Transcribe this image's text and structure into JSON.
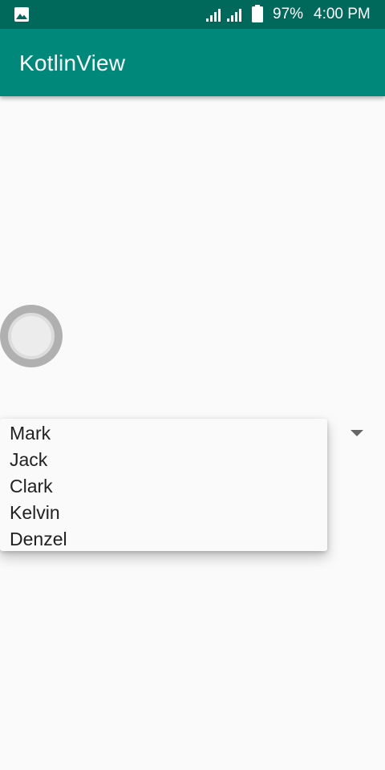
{
  "status_bar": {
    "notification_icon": "image-icon",
    "battery": "97%",
    "time": "4:00 PM"
  },
  "app_bar": {
    "title": "KotlinView"
  },
  "radio_button": {
    "checked": false
  },
  "spinner": {
    "dropdown_open": true,
    "options": [
      "Mark",
      "Jack",
      "Clark",
      "Kelvin",
      "Denzel"
    ]
  },
  "colors": {
    "status_bar": "#00695c",
    "app_bar": "#00897b",
    "background": "#fafafa",
    "text": "#212121"
  }
}
